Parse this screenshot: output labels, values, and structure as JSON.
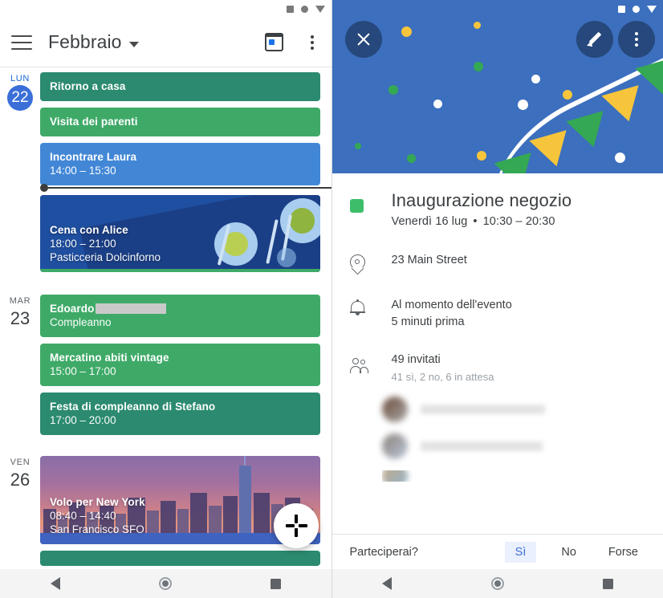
{
  "left": {
    "statusbar": {
      "icons": [
        "square-icon",
        "circle-icon",
        "triangle-down-icon"
      ]
    },
    "appbar": {
      "menu_icon": "hamburger-icon",
      "month": "Febbraio",
      "dropdown_icon": "chevron-down-icon",
      "today_icon": "calendar-today-icon",
      "overflow_icon": "more-vert-icon"
    },
    "days": [
      {
        "dow": "LUN",
        "num": "22",
        "today": true,
        "events": [
          {
            "kind": "flat",
            "title": "Ritorno a casa",
            "time": "",
            "color": "#2b8a6f"
          },
          {
            "kind": "flat",
            "title": "Visita dei parenti",
            "time": "",
            "color": "#3faa68"
          },
          {
            "kind": "flat",
            "title": "Incontrare Laura",
            "time": "14:00 – 15:30",
            "color": "#4287d6"
          },
          {
            "kind": "photo-dinner",
            "title": "Cena con Alice",
            "time": "18:00 – 21:00",
            "location": "Pasticceria Dolcinforno",
            "color": "#1f4fa0",
            "strip": "#3faa68"
          }
        ]
      },
      {
        "dow": "MAR",
        "num": "23",
        "today": false,
        "events": [
          {
            "kind": "flat",
            "title": "Edoardo",
            "time": "Compleanno",
            "color": "#3faa68",
            "redacted": true
          },
          {
            "kind": "flat",
            "title": "Mercatino abiti vintage",
            "time": "15:00 – 17:00",
            "color": "#3faa68"
          },
          {
            "kind": "flat",
            "title": "Festa di compleanno di Stefano",
            "time": "17:00 – 20:00",
            "color": "#2b8a6f"
          }
        ]
      },
      {
        "dow": "VEN",
        "num": "26",
        "today": false,
        "events": [
          {
            "kind": "photo-nyc",
            "title": "Volo per New York",
            "time": "08:40 – 14:40",
            "location": "San Francisco SFO",
            "color": "#a2709f",
            "strip": "#3f63c0"
          },
          {
            "kind": "flat",
            "title": "",
            "time": "",
            "color": "#2b8a6f"
          }
        ]
      }
    ],
    "fab": {
      "name": "create-event-fab",
      "icon": "google-plus-icon"
    },
    "nav": {
      "back": "back-icon",
      "home": "home-icon",
      "recents": "recents-icon"
    }
  },
  "right": {
    "statusbar": {
      "icons": [
        "square-icon",
        "circle-icon",
        "triangle-down-icon"
      ]
    },
    "hero": {
      "close_label": "close-icon",
      "edit_label": "edit-icon",
      "overflow_label": "more-vert-icon",
      "background_color": "#3c6fbe"
    },
    "event": {
      "color_swatch": "#3dbd6a",
      "title": "Inaugurazione negozio",
      "date": "Venerdì 16 lug",
      "separator": "•",
      "time": "10:30 – 20:30",
      "location_icon": "location-pin-icon",
      "location": "23 Main Street",
      "notification_icon": "bell-icon",
      "notification_1": "Al momento dell'evento",
      "notification_2": "5 minuti prima",
      "guests_icon": "people-icon",
      "guests_count": "49 invitati",
      "guests_breakdown": "41 sì, 2 no, 6 in attesa"
    },
    "rsvp": {
      "question": "Parteciperai?",
      "options": [
        {
          "label": "Sì",
          "selected": true
        },
        {
          "label": "No",
          "selected": false
        },
        {
          "label": "Forse",
          "selected": false
        }
      ],
      "selected_color": "#3b6fd4"
    },
    "nav": {
      "back": "back-icon",
      "home": "home-icon",
      "recents": "recents-icon"
    }
  }
}
